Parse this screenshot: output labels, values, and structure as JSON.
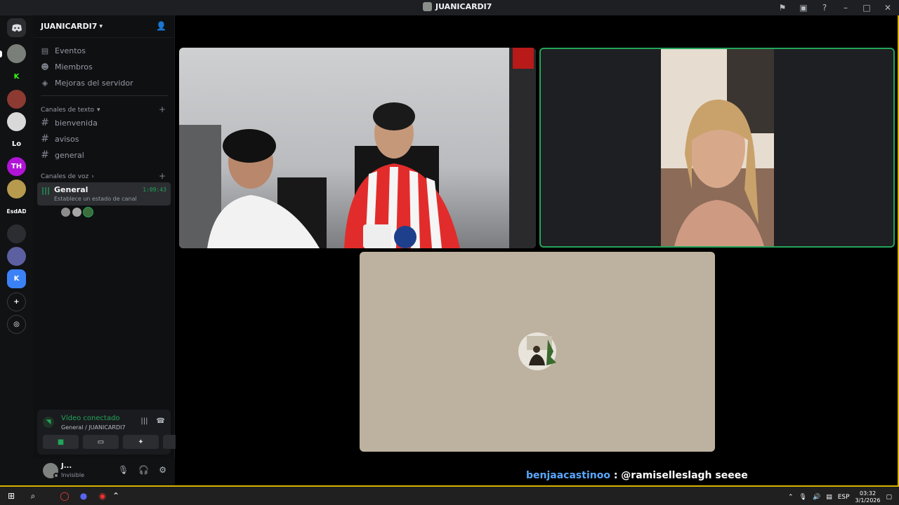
{
  "window": {
    "title": "JUANICARDI7"
  },
  "server": {
    "name": "JUANICARDI7"
  },
  "sidebar": {
    "nav": [
      {
        "label": "Eventos",
        "icon": "calendar-icon"
      },
      {
        "label": "Miembros",
        "icon": "members-icon"
      },
      {
        "label": "Mejoras del servidor",
        "icon": "boost-icon"
      }
    ],
    "text_category": "Canales de texto",
    "text_channels": [
      "bienvenida",
      "avisos",
      "general"
    ],
    "voice_category": "Canales de voz",
    "voice_channel": {
      "name": "General",
      "status": "Establece un estado de canal",
      "time": "1:09:43"
    }
  },
  "servers": [
    {
      "label": "",
      "color": "#7a7f7a"
    },
    {
      "label": "K",
      "color": "#111214",
      "text_color": "#39ff14"
    },
    {
      "label": "",
      "color": "#8c3a32"
    },
    {
      "label": "",
      "color": "#d9d9d9"
    },
    {
      "label": "Lo",
      "color": "#111214"
    },
    {
      "label": "TH",
      "color": "#b014d6"
    },
    {
      "label": "",
      "color": "#b69a4d"
    },
    {
      "label": "EsdAD",
      "color": "#111214"
    },
    {
      "label": "",
      "color": "#2b2d31"
    },
    {
      "label": "",
      "color": "#5c5fa0"
    },
    {
      "label": "K",
      "color": "#3b82f6"
    }
  ],
  "rtc": {
    "status": "Vídeo conectado",
    "location": "General / JUANICARDI7"
  },
  "user": {
    "name": "J...",
    "status": "Invisible"
  },
  "chat": {
    "user": "benjaacastinoo",
    "message": " : @ramiselleslagh seeee"
  },
  "taskbar": {
    "lang": "ESP",
    "time": "03:32",
    "date": "3/1/2026"
  },
  "colors": {
    "accent_green": "#23a55a",
    "frame_border": "#d7b300",
    "chat_user": "#5aa7ff"
  }
}
